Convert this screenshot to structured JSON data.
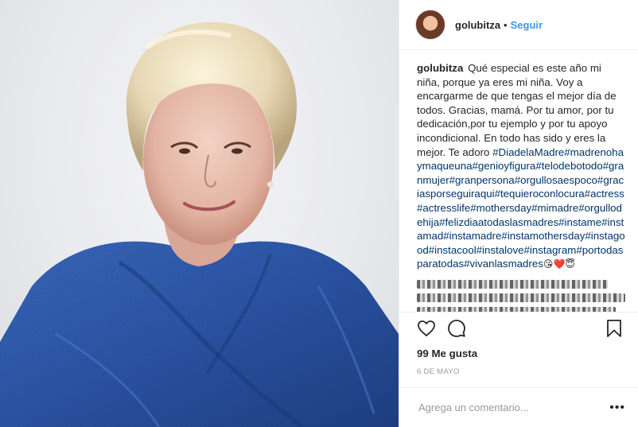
{
  "post": {
    "username": "golubitza",
    "separator": "•",
    "follow_label": "Seguir",
    "caption_text": "Qué especial es este año mi niña, porque ya eres mi niña. Voy a encargarme de que tengas el mejor día de todos. Gracias, mamá. Por tu amor, por tu dedicación,por tu ejemplo y por tu apoyo incondicional. En todo has sido y eres la mejor. Te adoro",
    "hashtags": "#DiadelaMadre#madrenohaymaqueuna#genioyfigura#telodebotodo#granmujer#granpersona#orgullosaespoco#graciasporseguiraqui#tequieroconlocura#actress#actresslife#mothersday#mimadre#orgullodehija#felizdiaatodaslasmadres#instame#instamad#instamadre#instamothersday#instagood#instacool#instalove#instagram#portodasparatodas#vivanlasmadres",
    "emoji_1": "😘",
    "emoji_2": "❤️",
    "emoji_3": "😇",
    "likes": "99 Me gusta",
    "date": "6 DE MAYO",
    "comment_placeholder": "Agrega un comentario...",
    "more_label": "•••"
  },
  "icons": {
    "like": "heart-outline-icon",
    "comment": "speech-bubble-icon",
    "save": "bookmark-icon",
    "more": "ellipsis-icon"
  },
  "colors": {
    "link_blue": "#3897f0",
    "hashtag_blue": "#003569",
    "text": "#262626",
    "muted": "#999999",
    "divider": "#efefef",
    "sweater_blue": "#2f58a8"
  }
}
